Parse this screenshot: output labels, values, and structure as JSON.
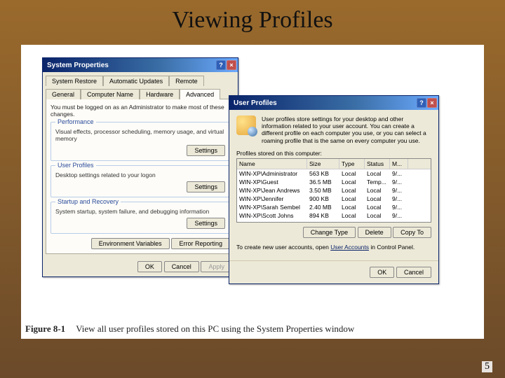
{
  "slide": {
    "title": "Viewing Profiles",
    "page": "5",
    "figure_label": "Figure 8-1",
    "figure_caption": "View all user profiles stored on this PC using the System Properties window"
  },
  "sysprop": {
    "title": "System Properties",
    "tabs_row1": [
      "System Restore",
      "Automatic Updates",
      "Remote"
    ],
    "tabs_row2": [
      "General",
      "Computer Name",
      "Hardware",
      "Advanced"
    ],
    "note": "You must be logged on as an Administrator to make most of these changes.",
    "groups": {
      "performance": {
        "legend": "Performance",
        "desc": "Visual effects, processor scheduling, memory usage, and virtual memory",
        "btn": "Settings"
      },
      "userprofiles": {
        "legend": "User Profiles",
        "desc": "Desktop settings related to your logon",
        "btn": "Settings"
      },
      "startup": {
        "legend": "Startup and Recovery",
        "desc": "System startup, system failure, and debugging information",
        "btn": "Settings"
      }
    },
    "env_btn": "Environment Variables",
    "err_btn": "Error Reporting",
    "ok": "OK",
    "cancel": "Cancel",
    "apply": "Apply"
  },
  "userprofiles": {
    "title": "User Profiles",
    "intro": "User profiles store settings for your desktop and other information related to your user account. You can create a different profile on each computer you use, or you can select a roaming profile that is the same on every computer you use.",
    "list_label": "Profiles stored on this computer:",
    "cols": [
      "Name",
      "Size",
      "Type",
      "Status",
      "M..."
    ],
    "rows": [
      {
        "name": "WIN-XP\\Administrator",
        "size": "563 KB",
        "type": "Local",
        "status": "Local",
        "mod": "9/..."
      },
      {
        "name": "WIN-XP\\Guest",
        "size": "36.5 MB",
        "type": "Local",
        "status": "Temp...",
        "mod": "9/..."
      },
      {
        "name": "WIN-XP\\Jean Andrews",
        "size": "3.50 MB",
        "type": "Local",
        "status": "Local",
        "mod": "9/..."
      },
      {
        "name": "WIN-XP\\Jennifer",
        "size": "900 KB",
        "type": "Local",
        "status": "Local",
        "mod": "9/..."
      },
      {
        "name": "WIN-XP\\Sarah Sembel",
        "size": "2.40 MB",
        "type": "Local",
        "status": "Local",
        "mod": "9/..."
      },
      {
        "name": "WIN-XP\\Scott Johns",
        "size": "894 KB",
        "type": "Local",
        "status": "Local",
        "mod": "9/..."
      }
    ],
    "change_type": "Change Type",
    "delete": "Delete",
    "copy_to": "Copy To",
    "create_note_pre": "To create new user accounts, open ",
    "create_link": "User Accounts",
    "create_note_post": " in Control Panel.",
    "ok": "OK",
    "cancel": "Cancel"
  }
}
